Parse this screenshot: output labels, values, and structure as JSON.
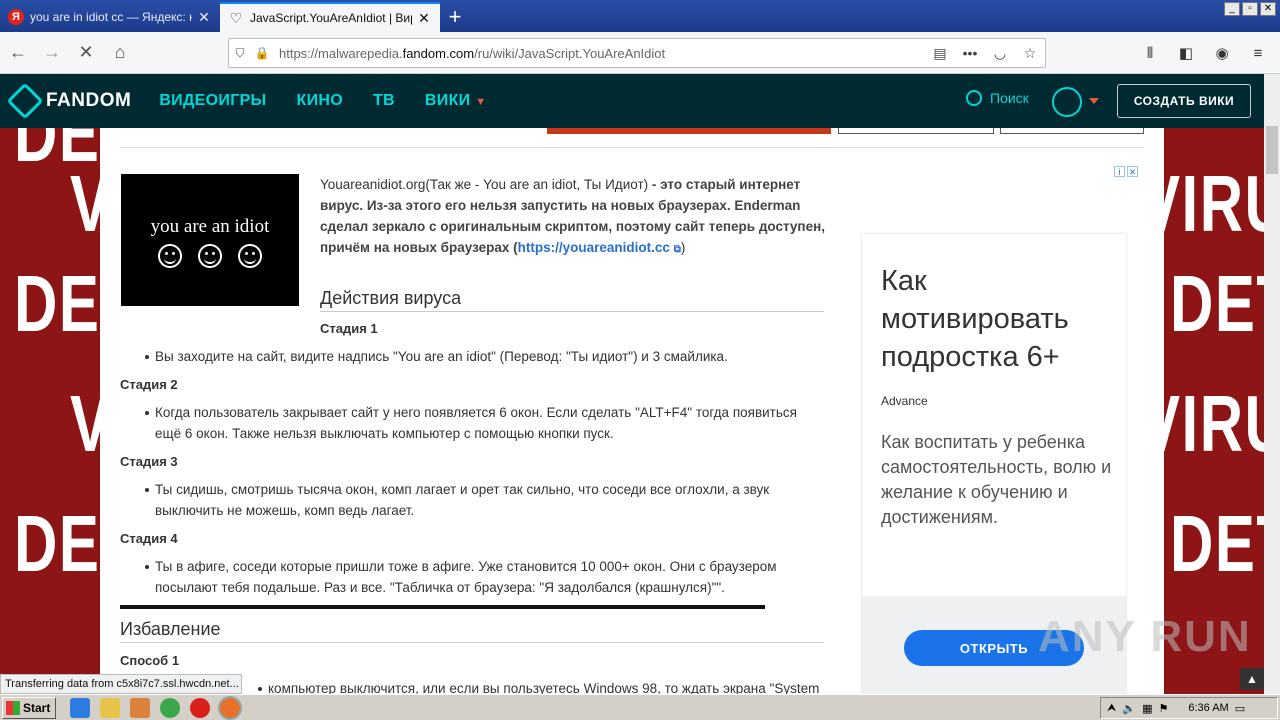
{
  "browser": {
    "tabs": [
      {
        "title": "you are in idiot cc — Яндекс: наш",
        "favicon": "yandex-icon",
        "active": false
      },
      {
        "title": "JavaScript.YouAreAnIdiot | Вирус",
        "favicon": "fandom-icon",
        "active": true
      }
    ],
    "url_prefix": "https://malwarepedia.",
    "url_domain": "fandom.com",
    "url_path": "/ru/wiki/JavaScript.YouAreAnIdiot",
    "status": "Transferring data from c5x8i7c7.ssl.hwcdn.net..."
  },
  "fandom": {
    "logo": "FANDOM",
    "nav": [
      "ВИДЕОИГРЫ",
      "КИНО",
      "ТВ",
      "ВИКИ"
    ],
    "search": "Поиск",
    "create_wiki": "СОЗДАТЬ ВИКИ"
  },
  "article": {
    "preview_text": "you are an idiot",
    "intro_normal": "Youareanidiot.org(Так же - You are an idiot, Ты Идиот)",
    "intro_bold": " - это старый интернет вирус. Из-за этого его нельзя запустить на новых браузерах. Enderman сделал зеркало с оригинальным скриптом, поэтому сайт теперь доступен, причём на новых браузерах (",
    "intro_link": "https://youareanidiot.cc",
    "intro_end": ")",
    "section1": "Действия вируса",
    "stage1": "Стадия 1",
    "stage1_text": "Вы заходите на сайт, видите надпись \"You are an idiot\" (Перевод: \"Ты идиот\") и 3 смайлика.",
    "stage2": "Стадия 2",
    "stage2_text": "Когда пользователь закрывает сайт у него появляется 6 окон. Если сделать \"ALT+F4\" тогда появиться ещё 6 окон. Также нельзя выключать компьютер с помощью кнопки пуск.",
    "stage3": "Стадия 3",
    "stage3_text": "Ты сидишь, смотришь тысяча окон, комп лагает и орет так сильно, что соседи все оглохли, а звук выключить не можешь, комп ведь лагает.",
    "stage4": "Стадия 4",
    "stage4_text": "Ты в афиге, соседи которые пришли тоже в афиге. Уже становится 10 000+ окон. Они с браузером посылают тебя подальше. Раз и все. \"Табличка от браузера: \"Я задолбался (крашнулся)\"\".",
    "section2": "Избавление",
    "method1": "Способ 1",
    "method1_text": "компьютер выключится, или если вы пользуетесь Windows 98, то ждать экрана \"System"
  },
  "ad": {
    "title": "Как мотивировать подростка 6+",
    "source": "Advance",
    "text": "Как воспитать у ребенка самостоятельность, волю и желание к обучению и достижениям.",
    "button": "ОТКРЫТЬ"
  },
  "background_words": [
    "DETE",
    "VIRUS",
    "DETECTI"
  ],
  "watermark": "ANY RUN",
  "taskbar": {
    "start": "Start",
    "clock": "6:36 AM"
  }
}
